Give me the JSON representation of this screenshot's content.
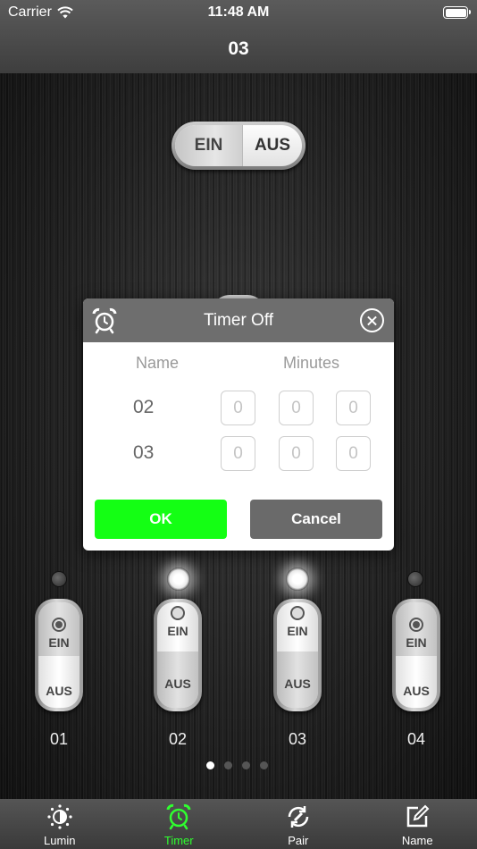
{
  "status_bar": {
    "carrier": "Carrier",
    "time": "11:48 AM"
  },
  "header": {
    "title": "03"
  },
  "master_switch": {
    "on_label": "EIN",
    "off_label": "AUS"
  },
  "dialog": {
    "title": "Timer Off",
    "col_name": "Name",
    "col_minutes": "Minutes",
    "rows": [
      {
        "name": "02",
        "digits": [
          "0",
          "0",
          "0"
        ],
        "placeholder": "0"
      },
      {
        "name": "03",
        "digits": [
          "0",
          "0",
          "0"
        ],
        "placeholder": "0"
      }
    ],
    "ok_label": "OK",
    "cancel_label": "Cancel"
  },
  "switches": [
    {
      "name": "01",
      "on_label": "EIN",
      "off_label": "AUS",
      "state": "on"
    },
    {
      "name": "02",
      "on_label": "EIN",
      "off_label": "AUS",
      "state": "off"
    },
    {
      "name": "03",
      "on_label": "EIN",
      "off_label": "AUS",
      "state": "off"
    },
    {
      "name": "04",
      "on_label": "EIN",
      "off_label": "AUS",
      "state": "on"
    }
  ],
  "pager": {
    "count": 4,
    "active": 0
  },
  "tabs": [
    {
      "label": "Lumin",
      "icon": "brightness-icon"
    },
    {
      "label": "Timer",
      "icon": "alarm-clock-icon",
      "active": true
    },
    {
      "label": "Pair",
      "icon": "pair-refresh-icon"
    },
    {
      "label": "Name",
      "icon": "edit-icon"
    }
  ],
  "colors": {
    "accent_green": "#14ff14",
    "tab_active": "#2fff2f",
    "dialog_header": "#6e6e6e"
  }
}
